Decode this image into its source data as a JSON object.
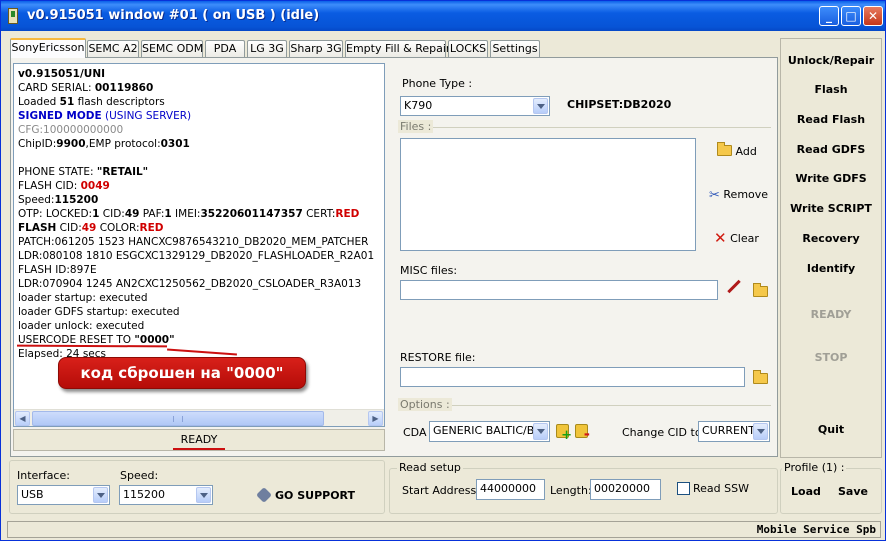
{
  "window": {
    "title": "v0.915051 window #01 ( on USB ) (idle)",
    "controls": {
      "minimize": "_",
      "maximize": "□",
      "close": "✕"
    }
  },
  "tabs": [
    {
      "label": "SonyEricsson",
      "active": true
    },
    {
      "label": "SEMC A2"
    },
    {
      "label": "SEMC ODM"
    },
    {
      "label": "PDA"
    },
    {
      "label": "LG 3G"
    },
    {
      "label": "Sharp 3G"
    },
    {
      "label": "Empty Fill & Repair"
    },
    {
      "label": "LOCKS"
    },
    {
      "label": "Settings"
    }
  ],
  "log": {
    "l1": "v0.915051/UNI",
    "l2a": "CARD SERIAL: ",
    "l2b": "00119860",
    "l3a": "Loaded ",
    "l3b": "51",
    "l3c": " flash descriptors",
    "l4a": "SIGNED MODE",
    "l4b": " (USING SERVER)",
    "l5": "CFG:100000000000",
    "l6a": "ChipID:",
    "l6b": "9900",
    "l6c": ",EMP protocol:",
    "l6d": "0301",
    "l8a": "PHONE STATE: ",
    "l8b": "\"RETAIL\"",
    "l9a": "FLASH CID: ",
    "l9b": "0049",
    "l10a": "Speed:",
    "l10b": "115200",
    "l11a": "OTP: LOCKED:",
    "l11b": "1",
    "l11c": " CID:",
    "l11d": "49",
    "l11e": " PAF:",
    "l11f": "1",
    "l11g": " IMEI:",
    "l11h": "35220601147357",
    "l11i": " CERT:",
    "l11j": "RED",
    "l12a": "FLASH",
    "l12b": " CID:",
    "l12c": "49",
    "l12d": " COLOR:",
    "l12e": "RED",
    "l13": "PATCH:061205 1523 HANCXC9876543210_DB2020_MEM_PATCHER",
    "l14": "LDR:080108 1810 ESGCXC1329129_DB2020_FLASHLOADER_R2A01",
    "l15": "FLASH ID:897E",
    "l16": "LDR:070904 1245 AN2CXC1250562_DB2020_CSLOADER_R3A013",
    "l17": "loader startup: executed",
    "l18": "loader GDFS startup: executed",
    "l19": "loader unlock: executed",
    "l20a": "USERCODE RESET TO ",
    "l20b": "\"0000\"",
    "l21": "Elapsed: 24 secs"
  },
  "status": {
    "ready": "READY"
  },
  "annotation": {
    "callout": "код сброшен на \"0000\""
  },
  "phone": {
    "type_label": "Phone Type :",
    "type_value": "K790",
    "chipset": "CHIPSET:DB2020"
  },
  "files": {
    "legend": "Files :",
    "add": "Add",
    "remove": "Remove",
    "clear": "Clear"
  },
  "misc": {
    "label": "MISC files:"
  },
  "restore": {
    "label": "RESTORE file:"
  },
  "options": {
    "legend": "Options :",
    "cda_label": "CDA",
    "cda_value": "GENERIC BALTIC/BA",
    "change_cid_label": "Change CID to",
    "change_cid_value": "CURRENT"
  },
  "actions": {
    "unlock": "Unlock/Repair",
    "flash": "Flash",
    "read_flash": "Read Flash",
    "read_gdfs": "Read GDFS",
    "write_gdfs": "Write GDFS",
    "write_script": "Write SCRIPT",
    "recovery": "Recovery",
    "identify": "Identify",
    "ready": "READY",
    "stop": "STOP",
    "quit": "Quit"
  },
  "bottom": {
    "interface_label": "Interface:",
    "interface_value": "USB",
    "speed_label": "Speed:",
    "speed_value": "115200",
    "go_support": "GO SUPPORT",
    "read_setup_legend": "Read setup",
    "start_label": "Start Address:",
    "start_value": "44000000",
    "length_label": "Length:",
    "length_value": "00020000",
    "read_ssw": "Read SSW",
    "profile_legend": "Profile (1) :",
    "load": "Load",
    "save": "Save"
  },
  "statusbar": {
    "brand": "Mobile Service Spb"
  },
  "colors": {
    "title_blue": "#0a5ce2",
    "callout_red": "#c7140e",
    "log_red": "#d00000",
    "signed_blue": "#0000c8"
  }
}
